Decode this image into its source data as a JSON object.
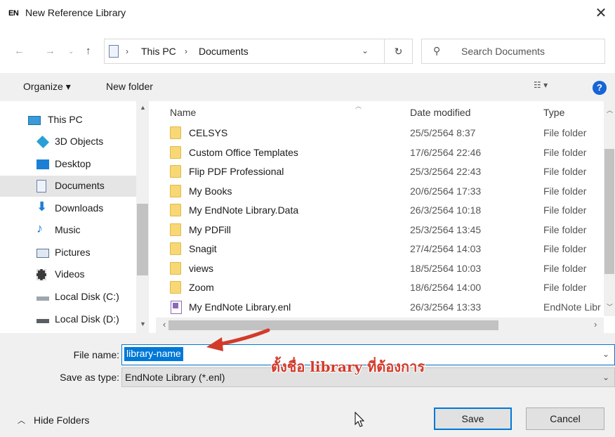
{
  "window": {
    "logo": "EN",
    "title": "New Reference Library",
    "close": "✕"
  },
  "address": {
    "crumbs": [
      "This PC",
      "Documents"
    ],
    "search_placeholder": "Search Documents"
  },
  "toolbar": {
    "organize": "Organize ▾",
    "new_folder": "New folder",
    "view": "☷ ▾",
    "help": "?"
  },
  "nav_items": [
    {
      "label": "This PC",
      "icon": "pc-icon"
    },
    {
      "label": "3D Objects",
      "icon": "cube-icon"
    },
    {
      "label": "Desktop",
      "icon": "desktop-icon"
    },
    {
      "label": "Documents",
      "icon": "documents-icon",
      "selected": true
    },
    {
      "label": "Downloads",
      "icon": "download-icon"
    },
    {
      "label": "Music",
      "icon": "music-icon"
    },
    {
      "label": "Pictures",
      "icon": "pictures-icon"
    },
    {
      "label": "Videos",
      "icon": "videos-icon"
    },
    {
      "label": "Local Disk (C:)",
      "icon": "disk-icon"
    },
    {
      "label": "Local Disk (D:)",
      "icon": "disk-icon"
    }
  ],
  "columns": {
    "name": "Name",
    "date": "Date modified",
    "type": "Type"
  },
  "files": [
    {
      "name": "CELSYS",
      "date": "25/5/2564 8:37",
      "type": "File folder",
      "kind": "folder"
    },
    {
      "name": "Custom Office Templates",
      "date": "17/6/2564 22:46",
      "type": "File folder",
      "kind": "folder"
    },
    {
      "name": "Flip PDF Professional",
      "date": "25/3/2564 22:43",
      "type": "File folder",
      "kind": "folder"
    },
    {
      "name": "My Books",
      "date": "20/6/2564 17:33",
      "type": "File folder",
      "kind": "folder"
    },
    {
      "name": "My EndNote Library.Data",
      "date": "26/3/2564 10:18",
      "type": "File folder",
      "kind": "folder"
    },
    {
      "name": "My PDFill",
      "date": "25/3/2564 13:45",
      "type": "File folder",
      "kind": "folder"
    },
    {
      "name": "Snagit",
      "date": "27/4/2564 14:03",
      "type": "File folder",
      "kind": "folder"
    },
    {
      "name": "views",
      "date": "18/5/2564 10:03",
      "type": "File folder",
      "kind": "folder"
    },
    {
      "name": "Zoom",
      "date": "18/6/2564 14:00",
      "type": "File folder",
      "kind": "folder"
    },
    {
      "name": "My EndNote Library.enl",
      "date": "26/3/2564 13:33",
      "type": "EndNote Libr",
      "kind": "enl"
    }
  ],
  "form": {
    "file_name_label": "File name:",
    "file_name_value": "library-name",
    "save_type_label": "Save as type:",
    "save_type_value": "EndNote Library (*.enl)"
  },
  "footer": {
    "hide_folders": "Hide Folders",
    "save": "Save",
    "cancel": "Cancel"
  },
  "annotation": {
    "text": "ตั้งชื่อ library ที่ต้องการ",
    "color": "#d23b2a"
  }
}
